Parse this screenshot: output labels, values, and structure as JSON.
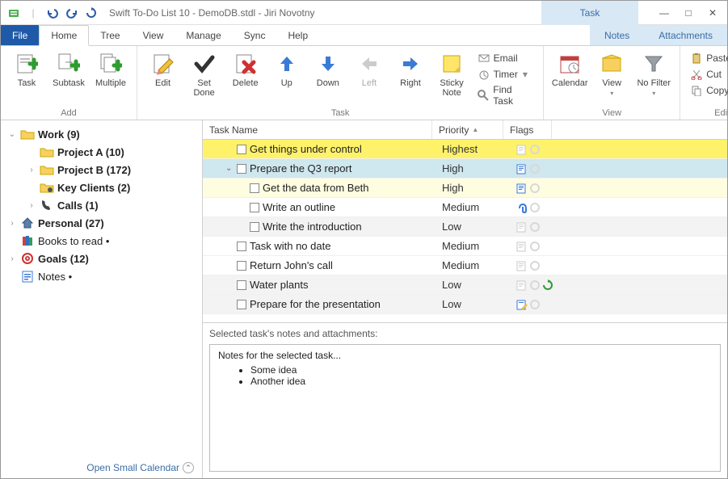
{
  "titlebar": {
    "title": "Swift To-Do List 10 - DemoDB.stdl - Jiri Novotny",
    "context_tab": "Task"
  },
  "menu": {
    "file": "File",
    "tabs": [
      "Home",
      "Tree",
      "View",
      "Manage",
      "Sync",
      "Help"
    ],
    "sub_tabs": [
      "Notes",
      "Attachments"
    ]
  },
  "ribbon": {
    "groups": {
      "add": {
        "label": "Add",
        "task": "Task",
        "subtask": "Subtask",
        "multiple": "Multiple"
      },
      "task": {
        "label": "Task",
        "edit": "Edit",
        "set_done": "Set\nDone",
        "delete": "Delete",
        "up": "Up",
        "down": "Down",
        "left": "Left",
        "right": "Right",
        "sticky": "Sticky\nNote",
        "email": "Email",
        "timer": "Timer",
        "find": "Find Task"
      },
      "view": {
        "label": "View",
        "calendar": "Calendar",
        "view": "View",
        "no_filter": "No Filter"
      },
      "edit": {
        "label": "Edit",
        "paste": "Paste",
        "cut": "Cut",
        "copy": "Copy"
      }
    }
  },
  "tree": {
    "items": [
      {
        "label": "Work (9)",
        "level": 0,
        "expander": "v",
        "icon": "folder",
        "bold": true
      },
      {
        "label": "Project A (10)",
        "level": 1,
        "expander": "",
        "icon": "folder",
        "bold": true
      },
      {
        "label": "Project B (172)",
        "level": 1,
        "expander": ">",
        "icon": "folder",
        "bold": true
      },
      {
        "label": "Key Clients (2)",
        "level": 1,
        "expander": "",
        "icon": "clients",
        "bold": true
      },
      {
        "label": "Calls (1)",
        "level": 1,
        "expander": ">",
        "icon": "phone",
        "bold": true
      },
      {
        "label": "Personal (27)",
        "level": 0,
        "expander": ">",
        "icon": "house",
        "bold": true
      },
      {
        "label": "Books to read •",
        "level": 0,
        "expander": "",
        "icon": "books",
        "bold": false
      },
      {
        "label": "Goals (12)",
        "level": 0,
        "expander": ">",
        "icon": "target",
        "bold": true
      },
      {
        "label": "Notes •",
        "level": 0,
        "expander": "",
        "icon": "notes",
        "bold": false
      }
    ],
    "open_calendar": "Open Small Calendar"
  },
  "grid": {
    "headers": {
      "name": "Task Name",
      "priority": "Priority",
      "flags": "Flags"
    },
    "rows": [
      {
        "name": "Get things under control",
        "priority": "Highest",
        "indent": 1,
        "expander": "",
        "bg": "#fff26b",
        "flag1": "note-gray"
      },
      {
        "name": "Prepare the Q3 report",
        "priority": "High",
        "indent": 1,
        "expander": "v",
        "bg": "#cfe7ef",
        "flag1": "note-blue"
      },
      {
        "name": "Get the data from Beth",
        "priority": "High",
        "indent": 2,
        "expander": "",
        "bg": "#fffde0",
        "flag1": "note-blue"
      },
      {
        "name": "Write an outline",
        "priority": "Medium",
        "indent": 2,
        "expander": "",
        "bg": "#ffffff",
        "flag1": "clip-blue"
      },
      {
        "name": "Write the introduction",
        "priority": "Low",
        "indent": 2,
        "expander": "",
        "bg": "#f3f3f3",
        "flag1": "note-gray"
      },
      {
        "name": "Task with no date",
        "priority": "Medium",
        "indent": 1,
        "expander": "",
        "bg": "#ffffff",
        "flag1": "note-gray"
      },
      {
        "name": "Return John's call",
        "priority": "Medium",
        "indent": 1,
        "expander": "",
        "bg": "#ffffff",
        "flag1": "note-gray"
      },
      {
        "name": "Water plants",
        "priority": "Low",
        "indent": 1,
        "expander": "",
        "bg": "#f3f3f3",
        "flag1": "note-gray",
        "recur": true
      },
      {
        "name": "Prepare for the presentation",
        "priority": "Low",
        "indent": 1,
        "expander": "",
        "bg": "#f3f3f3",
        "flag1": "note-blue-edit"
      }
    ]
  },
  "notes": {
    "header": "Selected task's notes and attachments:",
    "title": "Notes for the selected task...",
    "bullets": [
      "Some idea",
      "Another idea"
    ]
  }
}
